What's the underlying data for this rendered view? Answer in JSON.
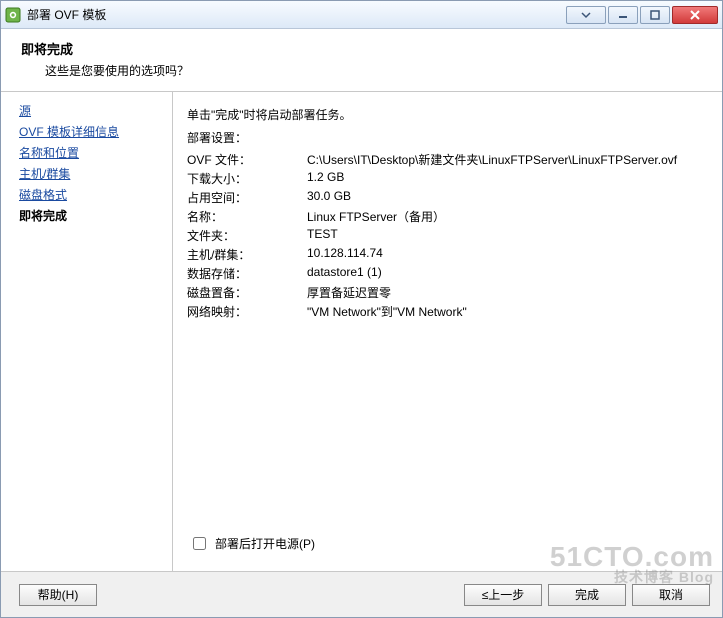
{
  "window": {
    "title": "部署 OVF 模板"
  },
  "header": {
    "title": "即将完成",
    "subtitle": "这些是您要使用的选项吗？"
  },
  "sidebar": {
    "steps": [
      {
        "label": "源",
        "current": false
      },
      {
        "label": "OVF 模板详细信息",
        "current": false
      },
      {
        "label": "名称和位置",
        "current": false
      },
      {
        "label": "主机/群集",
        "current": false
      },
      {
        "label": "磁盘格式",
        "current": false
      },
      {
        "label": "即将完成",
        "current": true
      }
    ]
  },
  "main": {
    "instruction": "单击\"完成\"时将启动部署任务。",
    "settings_label": "部署设置：",
    "rows": [
      {
        "key": "OVF 文件：",
        "value": "C:\\Users\\IT\\Desktop\\新建文件夹\\LinuxFTPServer\\LinuxFTPServer.ovf"
      },
      {
        "key": "下载大小：",
        "value": "1.2 GB"
      },
      {
        "key": "占用空间：",
        "value": "30.0 GB"
      },
      {
        "key": "名称：",
        "value": "Linux FTPServer（备用）"
      },
      {
        "key": "文件夹：",
        "value": "TEST"
      },
      {
        "key": "主机/群集：",
        "value": "10.128.114.74"
      },
      {
        "key": "数据存储：",
        "value": "datastore1 (1)"
      },
      {
        "key": "磁盘置备：",
        "value": "厚置备延迟置零"
      },
      {
        "key": "网络映射：",
        "value": "\"VM Network\"到\"VM Network\""
      }
    ],
    "power_on_label": "部署后打开电源(P)"
  },
  "footer": {
    "help": "帮助(H)",
    "back": "≤上一步",
    "finish": "完成",
    "cancel": "取消"
  },
  "watermark": {
    "main": "51CTO.com",
    "sub": "技术博客 Blog"
  }
}
